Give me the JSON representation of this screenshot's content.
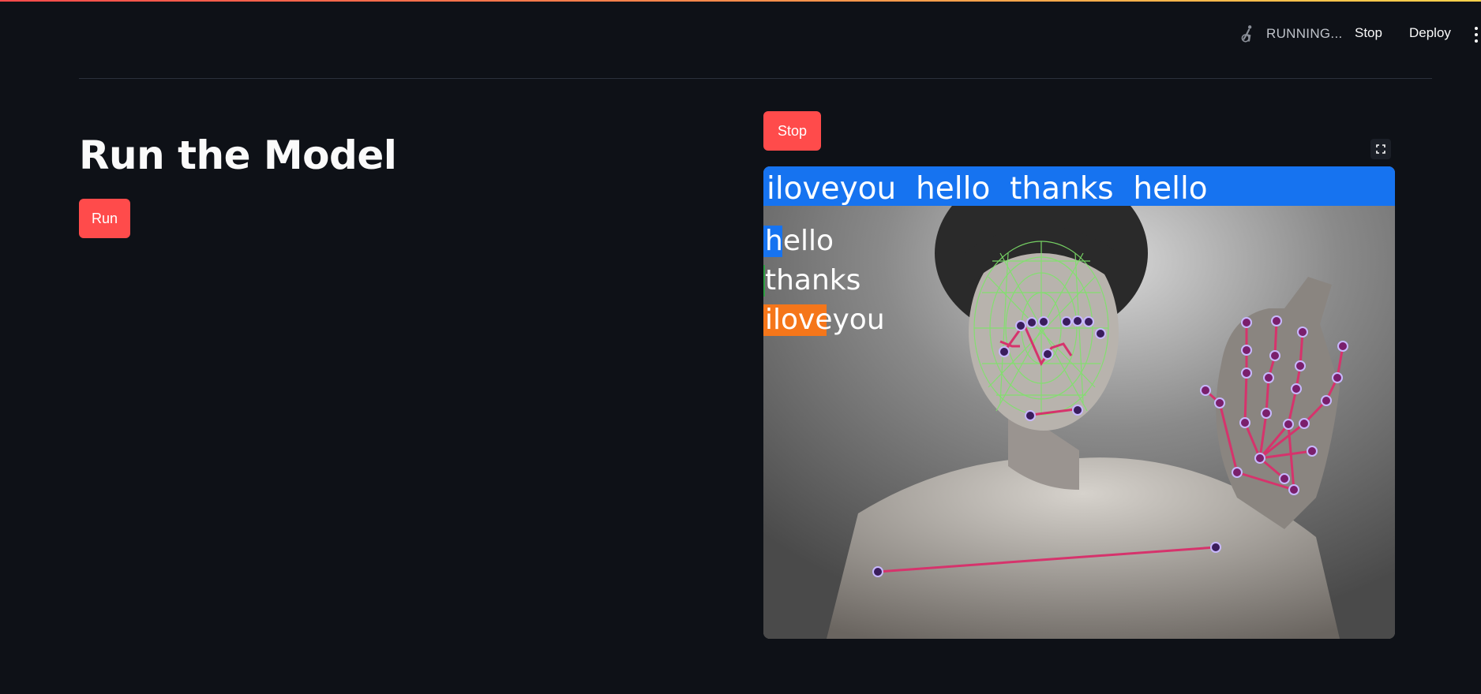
{
  "header": {
    "status_icon": "running-person-icon",
    "status_text": "RUNNING...",
    "stop_label": "Stop",
    "deploy_label": "Deploy",
    "menu_icon": "vertical-dots-icon"
  },
  "main": {
    "title": "Run the Model",
    "run_label": "Run"
  },
  "video_panel": {
    "stop_label": "Stop",
    "fullscreen_icon": "fullscreen-icon",
    "sentence": "iloveyou  hello  thanks  hello",
    "probabilities": [
      {
        "label": "hello",
        "value": 0.03,
        "color": "#1673f0"
      },
      {
        "label": "thanks",
        "value": 0.003,
        "color": "#2ea043"
      },
      {
        "label": "iloveyou",
        "value": 0.1,
        "color": "#f5761a"
      }
    ]
  },
  "colors": {
    "accent": "#ff4b4b",
    "background": "#0e1117",
    "prediction_bar": "#1673f0"
  }
}
